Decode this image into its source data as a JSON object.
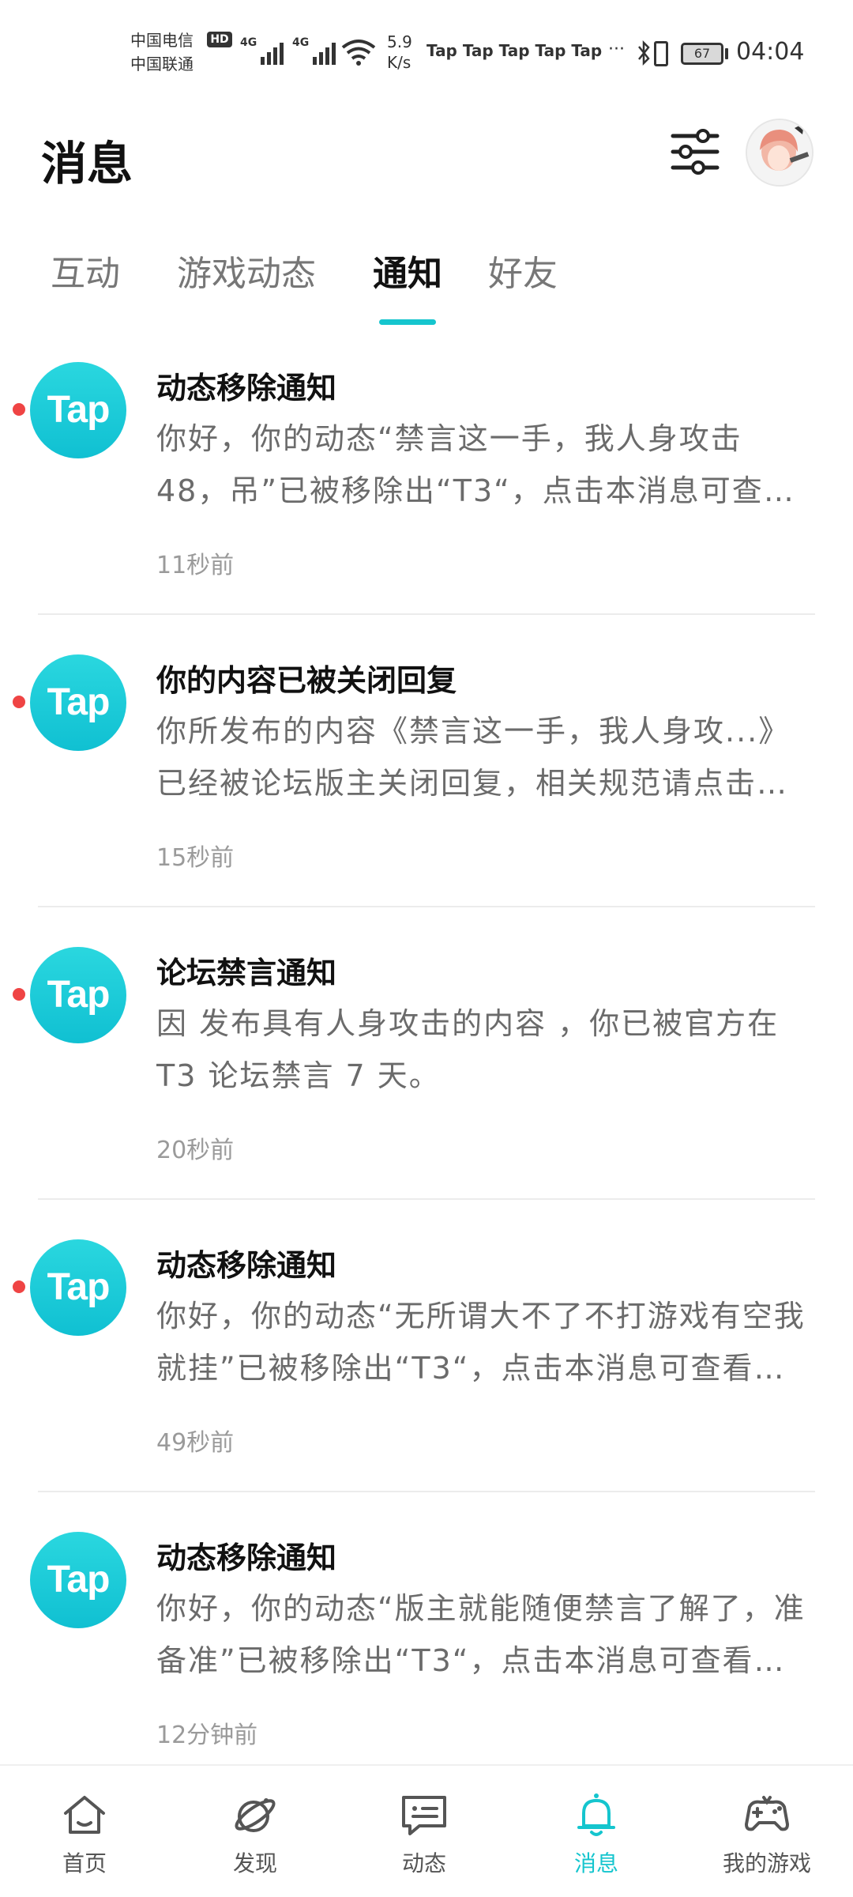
{
  "status_bar": {
    "carrier1": "中国电信",
    "carrier2": "中国联通",
    "hd": "HD",
    "net1": "4G",
    "net2": "4G",
    "speed_value": "5.9",
    "speed_unit": "K/s",
    "notif_apps": "Tap Tap Tap Tap Tap",
    "more": "···",
    "battery_level": "67",
    "time": "04:04"
  },
  "header": {
    "title": "消息"
  },
  "tabs": [
    {
      "label": "互动",
      "active": false
    },
    {
      "label": "游戏动态",
      "active": false
    },
    {
      "label": "通知",
      "active": true
    },
    {
      "label": "好友",
      "active": false
    }
  ],
  "notifications": [
    {
      "logo": "Tap",
      "title": "动态移除通知",
      "body": "你好，你的动态“禁言这一手，我人身攻击48，吊”已被移除出“T3“，点击本消息可查看详情",
      "time": "11秒前",
      "unread": true
    },
    {
      "logo": "Tap",
      "title": "你的内容已被关闭回复",
      "body": "你所发布的内容《禁言这一手，我人身攻...》已经被论坛版主关闭回复，相关规范请点击查看",
      "time": "15秒前",
      "unread": true
    },
    {
      "logo": "Tap",
      "title": "论坛禁言通知",
      "body": "因 发布具有人身攻击的内容 ，你已被官方在T3 论坛禁言 7 天。",
      "time": "20秒前",
      "unread": true
    },
    {
      "logo": "Tap",
      "title": "动态移除通知",
      "body": "你好，你的动态“无所谓大不了不打游戏有空我就挂”已被移除出“T3“，点击本消息可查看详情",
      "time": "49秒前",
      "unread": true
    },
    {
      "logo": "Tap",
      "title": "动态移除通知",
      "body": "你好，你的动态“版主就能随便禁言了解了，准备准”已被移除出“T3“，点击本消息可查看详情",
      "time": "12分钟前",
      "unread": false
    }
  ],
  "bottom_nav": [
    {
      "label": "首页",
      "icon": "home-icon",
      "active": false
    },
    {
      "label": "发现",
      "icon": "planet-icon",
      "active": false
    },
    {
      "label": "动态",
      "icon": "chat-bubble-icon",
      "active": false
    },
    {
      "label": "消息",
      "icon": "bell-icon",
      "active": true
    },
    {
      "label": "我的游戏",
      "icon": "gamepad-icon",
      "active": false
    }
  ],
  "colors": {
    "accent": "#15c5ce",
    "unread": "#ef4444",
    "tap_brand": "#14c6d6"
  }
}
